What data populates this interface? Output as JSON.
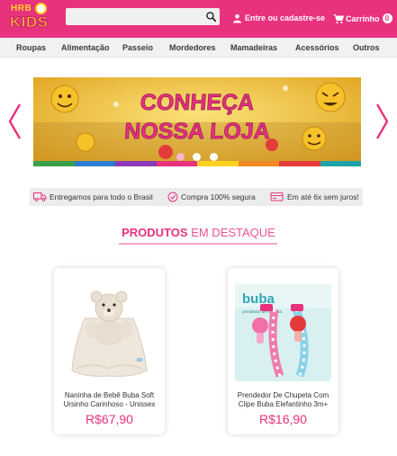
{
  "header": {
    "logo_top": "HRB",
    "logo_main": "KIDS",
    "search_placeholder": "",
    "login_label": "Entre ou cadastre-se",
    "cart_label": "Carrinho",
    "cart_count": "0",
    "colors": {
      "brand": "#e8327e",
      "logo": "#ffd21f"
    }
  },
  "nav": {
    "items": [
      {
        "label": "Roupas"
      },
      {
        "label": "Alimentação"
      },
      {
        "label": "Passeio"
      },
      {
        "label": "Mordedores"
      },
      {
        "label": "Mamadeiras"
      },
      {
        "label": "Acessórios"
      },
      {
        "label": "Outros"
      }
    ]
  },
  "banner": {
    "line1": "CONHEÇA",
    "line2": "NOSSA LOJA",
    "slides": 3,
    "active_slide": 1
  },
  "features": [
    {
      "icon": "truck-icon",
      "label": "Entregamos para todo o Brasil"
    },
    {
      "icon": "check-circle-icon",
      "label": "Compra 100% segura"
    },
    {
      "icon": "credit-card-icon",
      "label": "Em até 6x sem juros!"
    }
  ],
  "section": {
    "title_bold": "PRODUTOS",
    "title_light": "EM DESTAQUE"
  },
  "products": [
    {
      "name": "Naninha de Bebê Buba Soft Ursinho Carinhoso - Unissex",
      "price": "R$67,90"
    },
    {
      "name": "Prendedor De Chupeta Com Clipe Buba Elefantinho 3m+",
      "price": "R$16,90",
      "brand_mark": "buba",
      "pack_tag": "prendedor de chupeta"
    }
  ]
}
